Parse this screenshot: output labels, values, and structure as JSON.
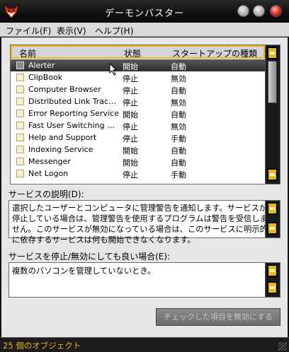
{
  "window": {
    "title": "デーモンバスター",
    "icon": "fox-head-icon"
  },
  "menu": [
    {
      "label": "ファイル(F)"
    },
    {
      "label": "表示(V)"
    },
    {
      "label": "ヘルプ(H)"
    }
  ],
  "service_list": {
    "columns": [
      "名前",
      "状態",
      "スタートアップの種類"
    ],
    "rows": [
      {
        "name": "Alerter",
        "state": "開始",
        "startup": "自動",
        "selected": true
      },
      {
        "name": "ClipBook",
        "state": "停止",
        "startup": "無効"
      },
      {
        "name": "Computer Browser",
        "state": "停止",
        "startup": "自動"
      },
      {
        "name": "Distributed Link Tracki...",
        "state": "停止",
        "startup": "無効"
      },
      {
        "name": "Error Reporting Service",
        "state": "開始",
        "startup": "自動"
      },
      {
        "name": "Fast User Switching C...",
        "state": "停止",
        "startup": "無効"
      },
      {
        "name": "Help and Support",
        "state": "停止",
        "startup": "手動"
      },
      {
        "name": "Indexing Service",
        "state": "開始",
        "startup": "自動"
      },
      {
        "name": "Messenger",
        "state": "開始",
        "startup": "自動"
      },
      {
        "name": "Net Logon",
        "state": "停止",
        "startup": "手動"
      }
    ]
  },
  "description": {
    "label": "サービスの説明(D):",
    "text": "選択したユーザーとコンピュータに管理警告を通知します。サービスが停止している場合は、管理警告を使用するプログラムは警告を受信しません。このサービスが無効になっている場合は、このサービスに明示的に依存するサービスは何も開始できなくなります。"
  },
  "safe_to_disable": {
    "label": "サービスを停止/無効にしても良い場合(E):",
    "text": "複数のパソコンを管理していないとき。"
  },
  "action_button": {
    "label": "チェックした項目を無効にする"
  },
  "status": {
    "text": "25 個のオブジェクト"
  },
  "colors": {
    "accent": "#e8b810",
    "titlebar": "#111111",
    "panel": "#e6e6e6",
    "close": "#d02424"
  }
}
